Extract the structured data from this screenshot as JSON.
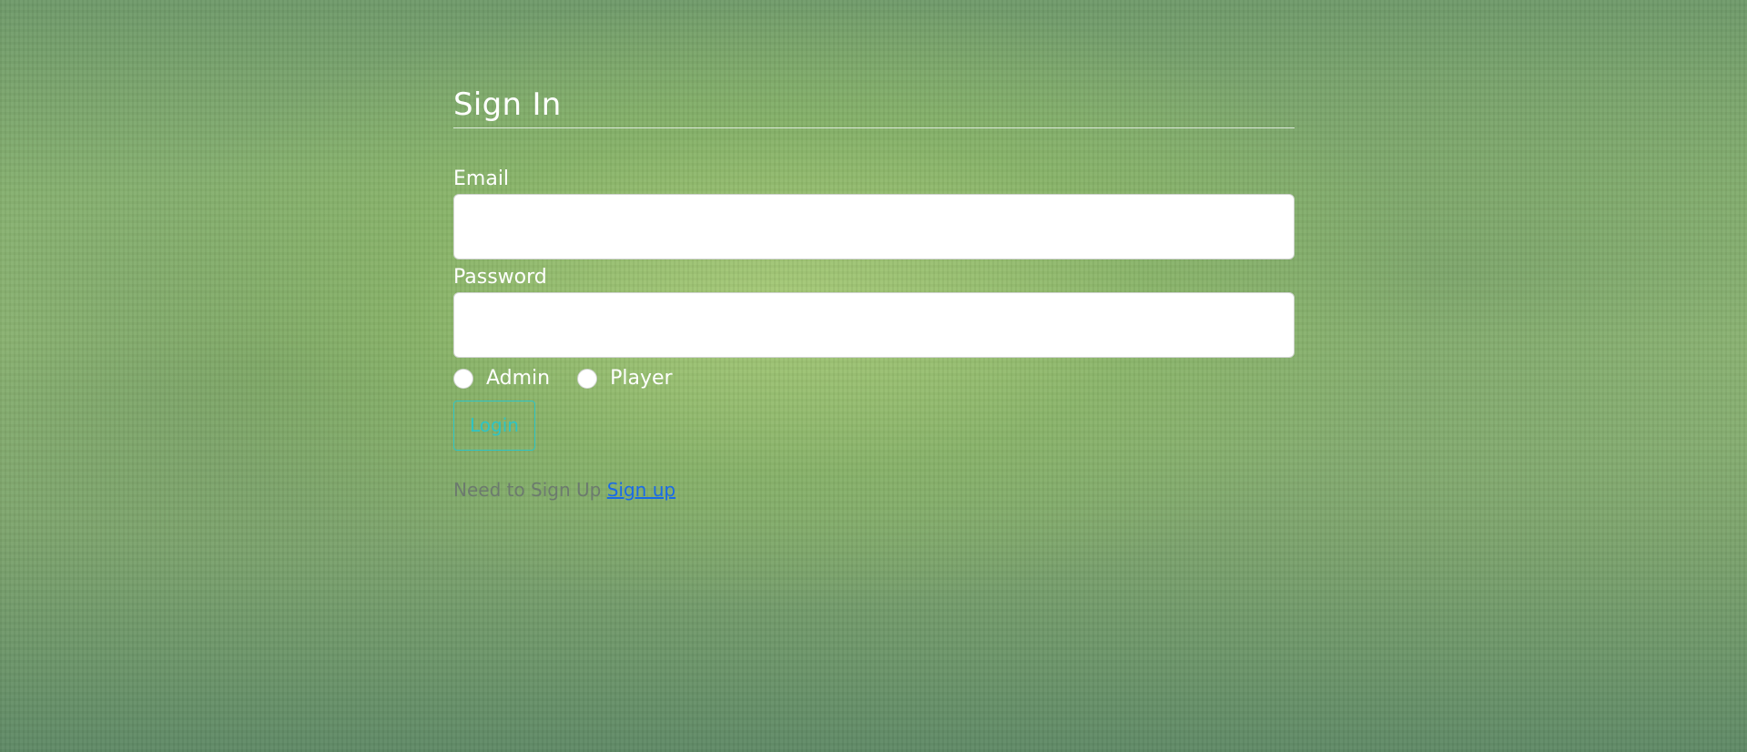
{
  "colors": {
    "accent": "#2ec4c4",
    "link": "#1a6ae8",
    "text_light": "#ffffff",
    "muted": "#6c7a6e"
  },
  "signin": {
    "title": "Sign In",
    "email_label": "Email",
    "email_value": "",
    "password_label": "Password",
    "password_value": "",
    "roles": [
      {
        "label": "Admin",
        "selected": false
      },
      {
        "label": "Player",
        "selected": false
      }
    ],
    "login_label": "Login",
    "signup_prompt": "Need to Sign Up",
    "signup_link": "Sign up"
  }
}
